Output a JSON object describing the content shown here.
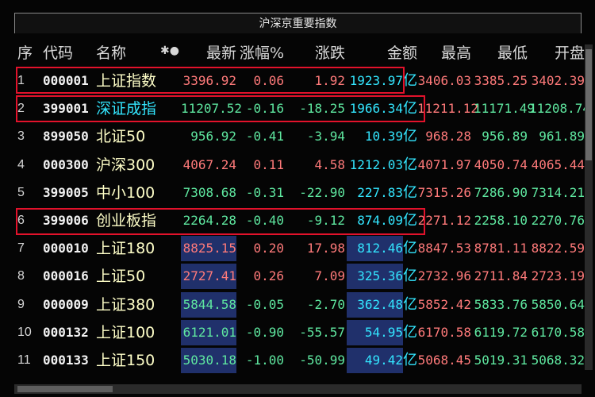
{
  "window": {
    "title": "沪深京重要指数"
  },
  "columns": {
    "seq": "序",
    "code": "代码",
    "name": "名称",
    "flag": "✱●",
    "latest": "最新",
    "pct": "涨幅%",
    "chg": "涨跌",
    "amount": "金额",
    "high": "最高",
    "low": "最低",
    "open": "开盘"
  },
  "unit": "亿",
  "rows": [
    {
      "seq": "1",
      "code": "000001",
      "name": "上证指数",
      "latest": "3396.92",
      "pct": "0.06",
      "chg": "1.92",
      "amount": "1923.97",
      "high": "3406.03",
      "low": "3385.25",
      "open": "3402.39"
    },
    {
      "seq": "2",
      "code": "399001",
      "name": "深证成指",
      "latest": "11207.52",
      "pct": "-0.16",
      "chg": "-18.25",
      "amount": "1966.34",
      "high": "11211.12",
      "low": "11171.49",
      "open": "11208.74"
    },
    {
      "seq": "3",
      "code": "899050",
      "name": "北证50",
      "latest": "956.92",
      "pct": "-0.41",
      "chg": "-3.94",
      "amount": "10.39",
      "high": "968.28",
      "low": "956.89",
      "open": "961.89"
    },
    {
      "seq": "4",
      "code": "000300",
      "name": "沪深300",
      "latest": "4067.24",
      "pct": "0.11",
      "chg": "4.58",
      "amount": "1212.03",
      "high": "4071.97",
      "low": "4050.74",
      "open": "4065.44"
    },
    {
      "seq": "5",
      "code": "399005",
      "name": "中小100",
      "latest": "7308.68",
      "pct": "-0.31",
      "chg": "-22.90",
      "amount": "227.83",
      "high": "7315.26",
      "low": "7286.90",
      "open": "7314.21"
    },
    {
      "seq": "6",
      "code": "399006",
      "name": "创业板指",
      "latest": "2264.28",
      "pct": "-0.40",
      "chg": "-9.12",
      "amount": "874.09",
      "high": "2271.12",
      "low": "2258.10",
      "open": "2270.76"
    },
    {
      "seq": "7",
      "code": "000010",
      "name": "上证180",
      "latest": "8825.15",
      "pct": "0.20",
      "chg": "17.98",
      "amount": "812.46",
      "high": "8847.53",
      "low": "8781.11",
      "open": "8822.59"
    },
    {
      "seq": "8",
      "code": "000016",
      "name": "上证50",
      "latest": "2727.41",
      "pct": "0.26",
      "chg": "7.09",
      "amount": "325.36",
      "high": "2732.96",
      "low": "2711.84",
      "open": "2723.19"
    },
    {
      "seq": "9",
      "code": "000009",
      "name": "上证380",
      "latest": "5844.58",
      "pct": "-0.05",
      "chg": "-2.70",
      "amount": "362.48",
      "high": "5852.42",
      "low": "5833.76",
      "open": "5850.64"
    },
    {
      "seq": "10",
      "code": "000132",
      "name": "上证100",
      "latest": "6121.01",
      "pct": "-0.90",
      "chg": "-55.57",
      "amount": "54.95",
      "high": "6170.58",
      "low": "6119.72",
      "open": "6170.58"
    },
    {
      "seq": "11",
      "code": "000133",
      "name": "上证150",
      "latest": "5030.18",
      "pct": "-1.00",
      "chg": "-50.99",
      "amount": "49.42",
      "high": "5068.45",
      "low": "5019.31",
      "open": "5068.32"
    }
  ],
  "colors": {
    "up": "#ff7a7a",
    "down": "#5fe8a0",
    "highlight": "#e2122b"
  }
}
